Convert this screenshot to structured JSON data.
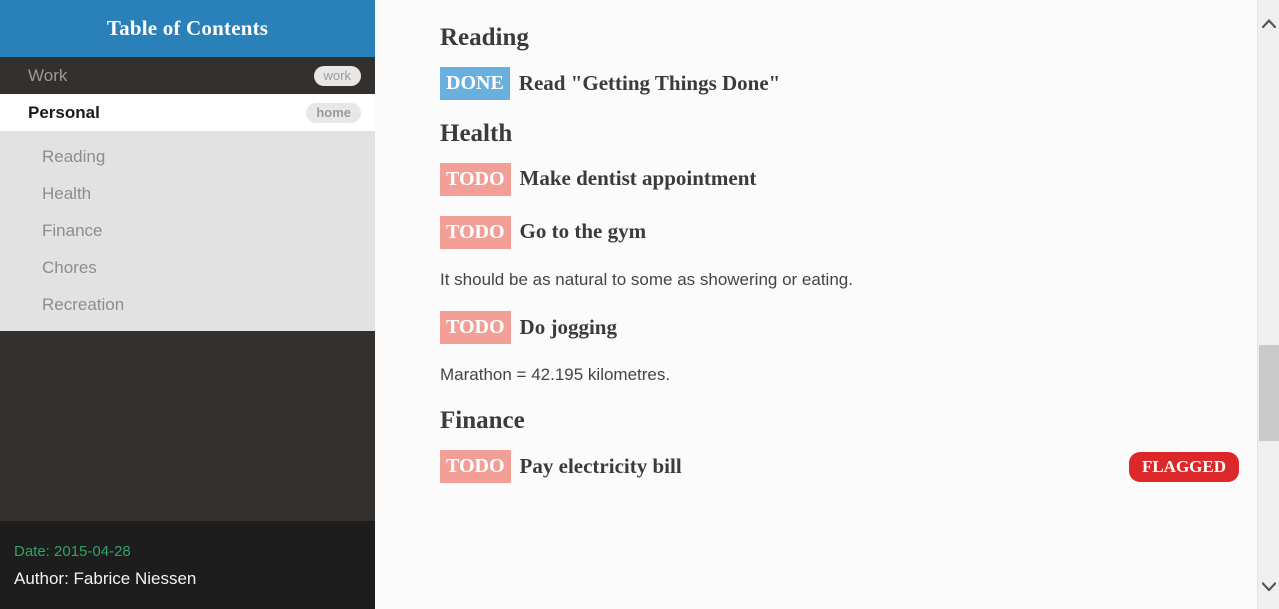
{
  "sidebar": {
    "header_title": "Table of Contents",
    "top_items": [
      {
        "label": "Work",
        "tag": "work",
        "active": false
      },
      {
        "label": "Personal",
        "tag": "home",
        "active": true
      }
    ],
    "sub_items": [
      {
        "label": "Reading"
      },
      {
        "label": "Health"
      },
      {
        "label": "Finance"
      },
      {
        "label": "Chores"
      },
      {
        "label": "Recreation"
      }
    ],
    "footer": {
      "date": "Date: 2015-04-28",
      "author": "Author: Fabrice Niessen"
    }
  },
  "content": {
    "sections": [
      {
        "heading": "Reading",
        "blocks": [
          {
            "kind": "task",
            "keyword": "DONE",
            "keyword_type": "done",
            "title": "Read \"Getting Things Done\"",
            "flag": null
          }
        ]
      },
      {
        "heading": "Health",
        "blocks": [
          {
            "kind": "task",
            "keyword": "TODO",
            "keyword_type": "todo",
            "title": "Make dentist appointment",
            "flag": null
          },
          {
            "kind": "task",
            "keyword": "TODO",
            "keyword_type": "todo",
            "title": "Go to the gym",
            "flag": null
          },
          {
            "kind": "para",
            "text": "It should be as natural to some as showering or eating."
          },
          {
            "kind": "task",
            "keyword": "TODO",
            "keyword_type": "todo",
            "title": "Do jogging",
            "flag": null
          },
          {
            "kind": "para",
            "text": "Marathon = 42.195 kilometres."
          }
        ]
      },
      {
        "heading": "Finance",
        "blocks": [
          {
            "kind": "task",
            "keyword": "TODO",
            "keyword_type": "todo",
            "title": "Pay electricity bill",
            "flag": "FLAGGED"
          }
        ]
      }
    ]
  },
  "scrollbar": {
    "up_arrow_icon": "chevron-up-icon",
    "down_arrow_icon": "chevron-down-icon"
  },
  "colors": {
    "header_blue": "#2a80b9",
    "sidebar_dark": "#33302e",
    "sidebar_footer": "#1d1d1d",
    "sublist_gray": "#e2e2e2",
    "done_badge": "#6ab0de",
    "todo_badge": "#f2a097",
    "flagged_red": "#dc2828",
    "date_green": "#2fa360",
    "content_bg": "#fbfbfb"
  }
}
